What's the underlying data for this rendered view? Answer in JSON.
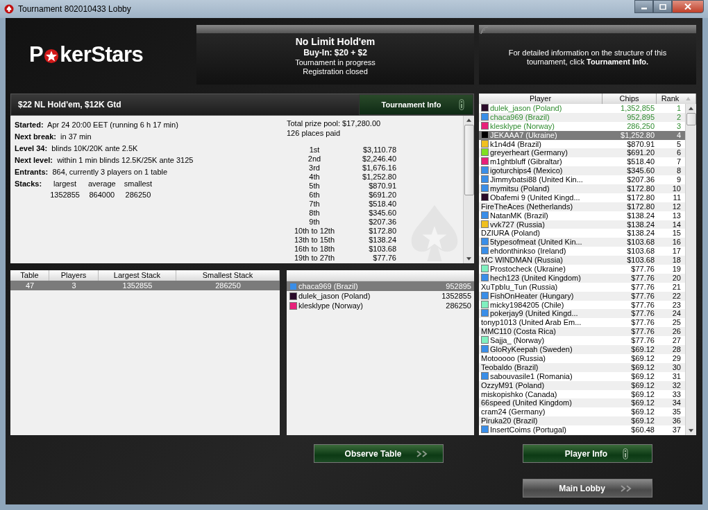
{
  "window": {
    "title": "Tournament 802010433 Lobby"
  },
  "logo": {
    "left": "P",
    "right": "kerStars"
  },
  "summary": {
    "game": "No Limit Hold'em",
    "buy_in_label": "Buy-In:",
    "buy_in": "$20 + $2",
    "status": "Tournament in progress",
    "registration": "Registration closed"
  },
  "info_note": "For detailed information on the structure of this tournament, click **Tournament Info.**",
  "tournament": {
    "name": "$22 NL Hold'em, $12K Gtd",
    "info_button": "Tournament Info",
    "details": [
      {
        "label": "Started:",
        "value": "Apr 24 20:00 EET (running 6 h 17 min)"
      },
      {
        "label": "Next break:",
        "value": "in 37 min"
      },
      {
        "label": "Level 34:",
        "value": "blinds 10K/20K ante 2.5K"
      },
      {
        "label": "Next level:",
        "value": "within 1 min blinds 12.5K/25K ante 3125"
      },
      {
        "label": "Entrants:",
        "value": "864, currently 3 players on 1 table"
      }
    ],
    "stacks": {
      "label": "Stacks:",
      "columns": [
        {
          "heading": "largest",
          "value": "1352855"
        },
        {
          "heading": "average",
          "value": "864000"
        },
        {
          "heading": "smallest",
          "value": "286250"
        }
      ]
    },
    "prize_pool": "Total prize pool: $17,280.00",
    "places_paid": "126 places paid",
    "payouts": [
      {
        "place": "1st",
        "amount": "$3,110.78"
      },
      {
        "place": "2nd",
        "amount": "$2,246.40"
      },
      {
        "place": "3rd",
        "amount": "$1,676.16"
      },
      {
        "place": "4th",
        "amount": "$1,252.80"
      },
      {
        "place": "5th",
        "amount": "$870.91"
      },
      {
        "place": "6th",
        "amount": "$691.20"
      },
      {
        "place": "7th",
        "amount": "$518.40"
      },
      {
        "place": "8th",
        "amount": "$345.60"
      },
      {
        "place": "9th",
        "amount": "$207.36"
      },
      {
        "place": "10th to 12th",
        "amount": "$172.80"
      },
      {
        "place": "13th to 15th",
        "amount": "$138.24"
      },
      {
        "place": "16th to 18th",
        "amount": "$103.68"
      },
      {
        "place": "19th to 27th",
        "amount": "$77.76"
      }
    ]
  },
  "tables": {
    "columns": [
      "Table",
      "Players",
      "Largest Stack",
      "Smallest Stack"
    ],
    "rows": [
      {
        "cells": [
          "47",
          "3",
          "1352855",
          "286250"
        ],
        "selected": true
      }
    ]
  },
  "table_players": [
    {
      "name": "chaca969 (Brazil)",
      "chips": "952895",
      "color": "#3a8ee8",
      "selected": true
    },
    {
      "name": "dulek_jason (Poland)",
      "chips": "1352855",
      "color": "#2a0a2a",
      "selected": false
    },
    {
      "name": "klesklype (Norway)",
      "chips": "286250",
      "color": "#e8207a",
      "selected": false
    }
  ],
  "players": {
    "columns": [
      "Player",
      "Chips",
      "Rank"
    ],
    "rows": [
      {
        "name": "dulek_jason (Poland)",
        "chips": "1,352,855",
        "rank": "1",
        "color": "#2a0a2a",
        "in_play": true,
        "selected": false
      },
      {
        "name": "chaca969 (Brazil)",
        "chips": "952,895",
        "rank": "2",
        "color": "#3a8ee8",
        "in_play": true,
        "selected": false
      },
      {
        "name": "klesklype (Norway)",
        "chips": "286,250",
        "rank": "3",
        "color": "#e8207a",
        "in_play": true,
        "selected": false
      },
      {
        "name": "JEKAAA7 (Ukraine)",
        "chips": "$1,252.80",
        "rank": "4",
        "color": "#000000",
        "in_play": false,
        "selected": true
      },
      {
        "name": "k1n4d4 (Brazil)",
        "chips": "$870.91",
        "rank": "5",
        "color": "#f0c020",
        "in_play": false,
        "selected": false
      },
      {
        "name": "greyerheart (Germany)",
        "chips": "$691.20",
        "rank": "6",
        "color": "#80e020",
        "in_play": false,
        "selected": false
      },
      {
        "name": "m1ghtbluff (Gibraltar)",
        "chips": "$518.40",
        "rank": "7",
        "color": "#e8207a",
        "in_play": false,
        "selected": false
      },
      {
        "name": "igoturchips4 (Mexico)",
        "chips": "$345.60",
        "rank": "8",
        "color": "#3a8ee8",
        "in_play": false,
        "selected": false
      },
      {
        "name": "Jimmybatsi88 (United Kin...",
        "chips": "$207.36",
        "rank": "9",
        "color": "#3a8ee8",
        "in_play": false,
        "selected": false
      },
      {
        "name": "mymitsu (Poland)",
        "chips": "$172.80",
        "rank": "10",
        "color": "#3a8ee8",
        "in_play": false,
        "selected": false
      },
      {
        "name": "Obafemi 9 (United Kingd...",
        "chips": "$172.80",
        "rank": "11",
        "color": "#2a0a2a",
        "in_play": false,
        "selected": false
      },
      {
        "name": "FireTheAces (Netherlands)",
        "chips": "$172.80",
        "rank": "12",
        "in_play": false,
        "selected": false
      },
      {
        "name": "NatanMK (Brazil)",
        "chips": "$138.24",
        "rank": "13",
        "color": "#3a8ee8",
        "in_play": false,
        "selected": false
      },
      {
        "name": "vvk727 (Russia)",
        "chips": "$138.24",
        "rank": "14",
        "color": "#f0c020",
        "in_play": false,
        "selected": false
      },
      {
        "name": "DZIURA (Poland)",
        "chips": "$138.24",
        "rank": "15",
        "in_play": false,
        "selected": false
      },
      {
        "name": "5typesofmeat (United Kin...",
        "chips": "$103.68",
        "rank": "16",
        "color": "#3a8ee8",
        "in_play": false,
        "selected": false
      },
      {
        "name": "ehdonthinkso (Ireland)",
        "chips": "$103.68",
        "rank": "17",
        "color": "#3a8ee8",
        "in_play": false,
        "selected": false
      },
      {
        "name": "MC WINDMAN (Russia)",
        "chips": "$103.68",
        "rank": "18",
        "in_play": false,
        "selected": false
      },
      {
        "name": "Prostocheck (Ukraine)",
        "chips": "$77.76",
        "rank": "19",
        "color": "#80f0c0",
        "in_play": false,
        "selected": false
      },
      {
        "name": "hech123 (United Kingdom)",
        "chips": "$77.76",
        "rank": "20",
        "color": "#3a8ee8",
        "in_play": false,
        "selected": false
      },
      {
        "name": "XuTpbIu_Tun (Russia)",
        "chips": "$77.76",
        "rank": "21",
        "in_play": false,
        "selected": false
      },
      {
        "name": "FishOnHeater (Hungary)",
        "chips": "$77.76",
        "rank": "22",
        "color": "#3a8ee8",
        "in_play": false,
        "selected": false
      },
      {
        "name": "micky1984205 (Chile)",
        "chips": "$77.76",
        "rank": "23",
        "color": "#80f0c0",
        "in_play": false,
        "selected": false
      },
      {
        "name": "pokerjay9 (United Kingd...",
        "chips": "$77.76",
        "rank": "24",
        "color": "#3a8ee8",
        "in_play": false,
        "selected": false
      },
      {
        "name": "tonyp1013 (United Arab Em...",
        "chips": "$77.76",
        "rank": "25",
        "in_play": false,
        "selected": false
      },
      {
        "name": "MMC110 (Costa Rica)",
        "chips": "$77.76",
        "rank": "26",
        "in_play": false,
        "selected": false
      },
      {
        "name": "Sajja_ (Norway)",
        "chips": "$77.76",
        "rank": "27",
        "color": "#80f0c0",
        "in_play": false,
        "selected": false
      },
      {
        "name": "GloRyKeepah (Sweden)",
        "chips": "$69.12",
        "rank": "28",
        "color": "#3a8ee8",
        "in_play": false,
        "selected": false
      },
      {
        "name": "Motooooo (Russia)",
        "chips": "$69.12",
        "rank": "29",
        "in_play": false,
        "selected": false
      },
      {
        "name": "Teobaldo (Brazil)",
        "chips": "$69.12",
        "rank": "30",
        "in_play": false,
        "selected": false
      },
      {
        "name": "sabouvasile1 (Romania)",
        "chips": "$69.12",
        "rank": "31",
        "color": "#3a8ee8",
        "in_play": false,
        "selected": false
      },
      {
        "name": "OzzyM91 (Poland)",
        "chips": "$69.12",
        "rank": "32",
        "in_play": false,
        "selected": false
      },
      {
        "name": "miskopishko (Canada)",
        "chips": "$69.12",
        "rank": "33",
        "in_play": false,
        "selected": false
      },
      {
        "name": "66speed (United Kingdom)",
        "chips": "$69.12",
        "rank": "34",
        "in_play": false,
        "selected": false
      },
      {
        "name": "cram24 (Germany)",
        "chips": "$69.12",
        "rank": "35",
        "in_play": false,
        "selected": false
      },
      {
        "name": "Piruka20 (Brazil)",
        "chips": "$69.12",
        "rank": "36",
        "in_play": false,
        "selected": false
      },
      {
        "name": "InsertCoims (Portugal)",
        "chips": "$60.48",
        "rank": "37",
        "color": "#3a8ee8",
        "in_play": false,
        "selected": false
      }
    ]
  },
  "buttons": [
    {
      "label": "Observe Table",
      "highlighted": true,
      "kind": "arrows"
    },
    {
      "label": "Player Info",
      "highlighted": true,
      "kind": "info"
    },
    {
      "label": "Main Lobby",
      "highlighted": false,
      "kind": "arrows"
    }
  ]
}
